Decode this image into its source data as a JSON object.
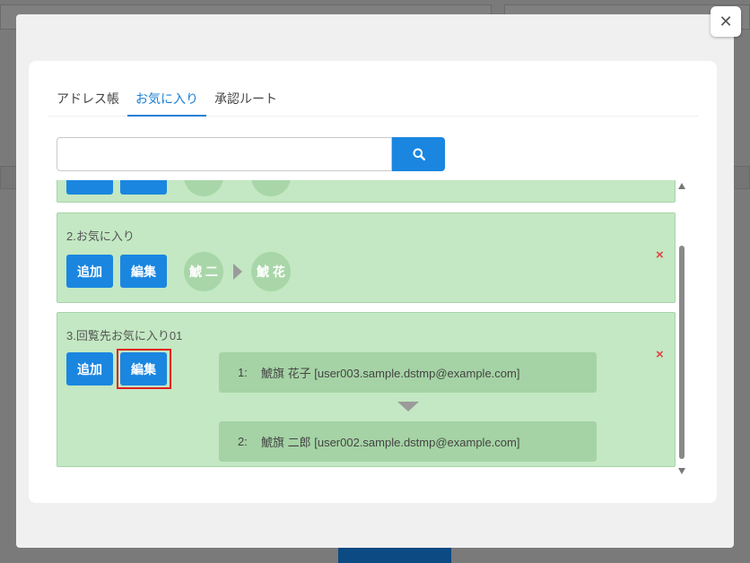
{
  "modal": {
    "close_glyph": "✕"
  },
  "tabs": [
    {
      "label": "アドレス帳"
    },
    {
      "label": "お気に入り"
    },
    {
      "label": "承認ルート"
    }
  ],
  "search": {
    "value": "",
    "icon": "search-icon"
  },
  "items": [
    {
      "title": "2.お気に入り",
      "add_label": "追加",
      "edit_label": "編集",
      "route": [
        {
          "avatar": "鯱 二"
        },
        {
          "avatar": "鯱 花"
        }
      ],
      "delete_glyph": "×"
    },
    {
      "title": "3.回覧先お気に入り01",
      "add_label": "追加",
      "edit_label": "編集",
      "steps": [
        {
          "num": "1:",
          "text": "鯱旗 花子 [user003.sample.dstmp@example.com]"
        },
        {
          "num": "2:",
          "text": "鯱旗 二郎 [user002.sample.dstmp@example.com]"
        }
      ],
      "delete_glyph": "×"
    }
  ],
  "colors": {
    "accent": "#1a86e0",
    "item_bg": "#c3e8c3",
    "route_bg": "#a5d3a5",
    "delete": "#e04646",
    "highlight": "#e02020"
  }
}
